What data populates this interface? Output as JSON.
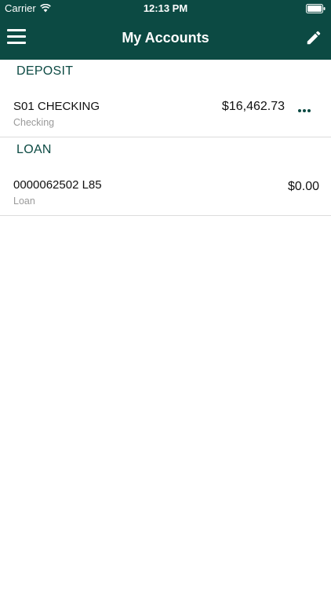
{
  "status_bar": {
    "carrier": "Carrier",
    "time": "12:13 PM",
    "wifi_icon": "wifi-icon",
    "battery_icon": "battery-icon"
  },
  "nav": {
    "title": "My Accounts",
    "menu_icon": "hamburger-menu-icon",
    "edit_icon": "pencil-icon"
  },
  "colors": {
    "header_bg": "#0c4a43",
    "accent": "#0c4a43",
    "divider": "#dcdcdc",
    "secondary_text": "#9a9a9a"
  },
  "sections": [
    {
      "header": "DEPOSIT",
      "accounts": [
        {
          "name": "S01 CHECKING",
          "type": "Checking",
          "balance": "$16,462.73",
          "more_icon": "ellipsis-icon"
        }
      ]
    },
    {
      "header": "LOAN",
      "accounts": [
        {
          "name": "0000062502 L85",
          "type": "Loan",
          "balance": "$0.00"
        }
      ]
    }
  ]
}
